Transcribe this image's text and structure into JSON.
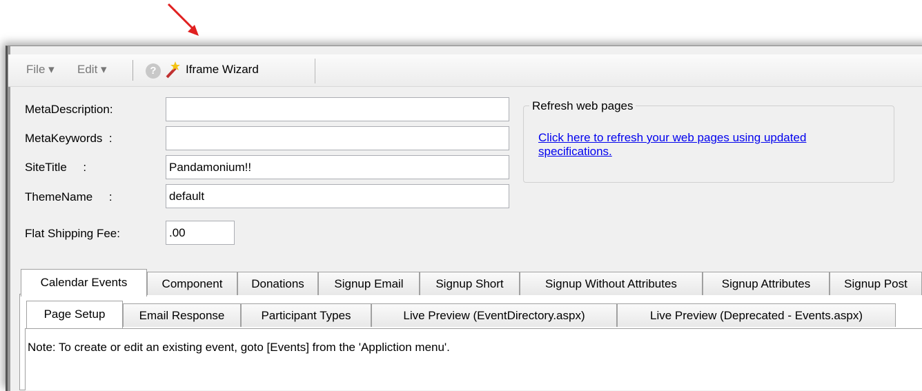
{
  "toolbar": {
    "file_label": "File ▾",
    "edit_label": "Edit ▾",
    "help_icon": "help-icon",
    "wizard_icon": "magic-wand-icon",
    "wizard_label": "Iframe Wizard"
  },
  "form": {
    "meta_description_label": "MetaDescription:",
    "meta_description_value": "",
    "meta_keywords_label": "MetaKeywords  :",
    "meta_keywords_value": "",
    "site_title_label": "SiteTitle     :",
    "site_title_value": "Pandamonium!!",
    "theme_name_label": "ThemeName     :",
    "theme_name_value": "default",
    "flat_shipping_label": "Flat Shipping Fee:",
    "flat_shipping_value": ".00"
  },
  "refresh_group": {
    "title": "Refresh web pages",
    "link_text": "Click here to refresh your web pages using updated specifications."
  },
  "tabs_top": [
    "Calendar Events",
    "Component",
    "Donations",
    "Signup Email",
    "Signup Short",
    "Signup Without Attributes",
    "Signup Attributes",
    "Signup Post"
  ],
  "tabs_sub": [
    "Page Setup",
    "Email Response",
    "Participant Types",
    "Live Preview (EventDirectory.aspx)",
    "Live Preview (Deprecated - Events.aspx)"
  ],
  "note": "Note: To create or edit an existing event, goto [Events] from the 'Appliction menu'.",
  "colors": {
    "annotation_arrow": "#e02020",
    "link": "#0000ee"
  }
}
